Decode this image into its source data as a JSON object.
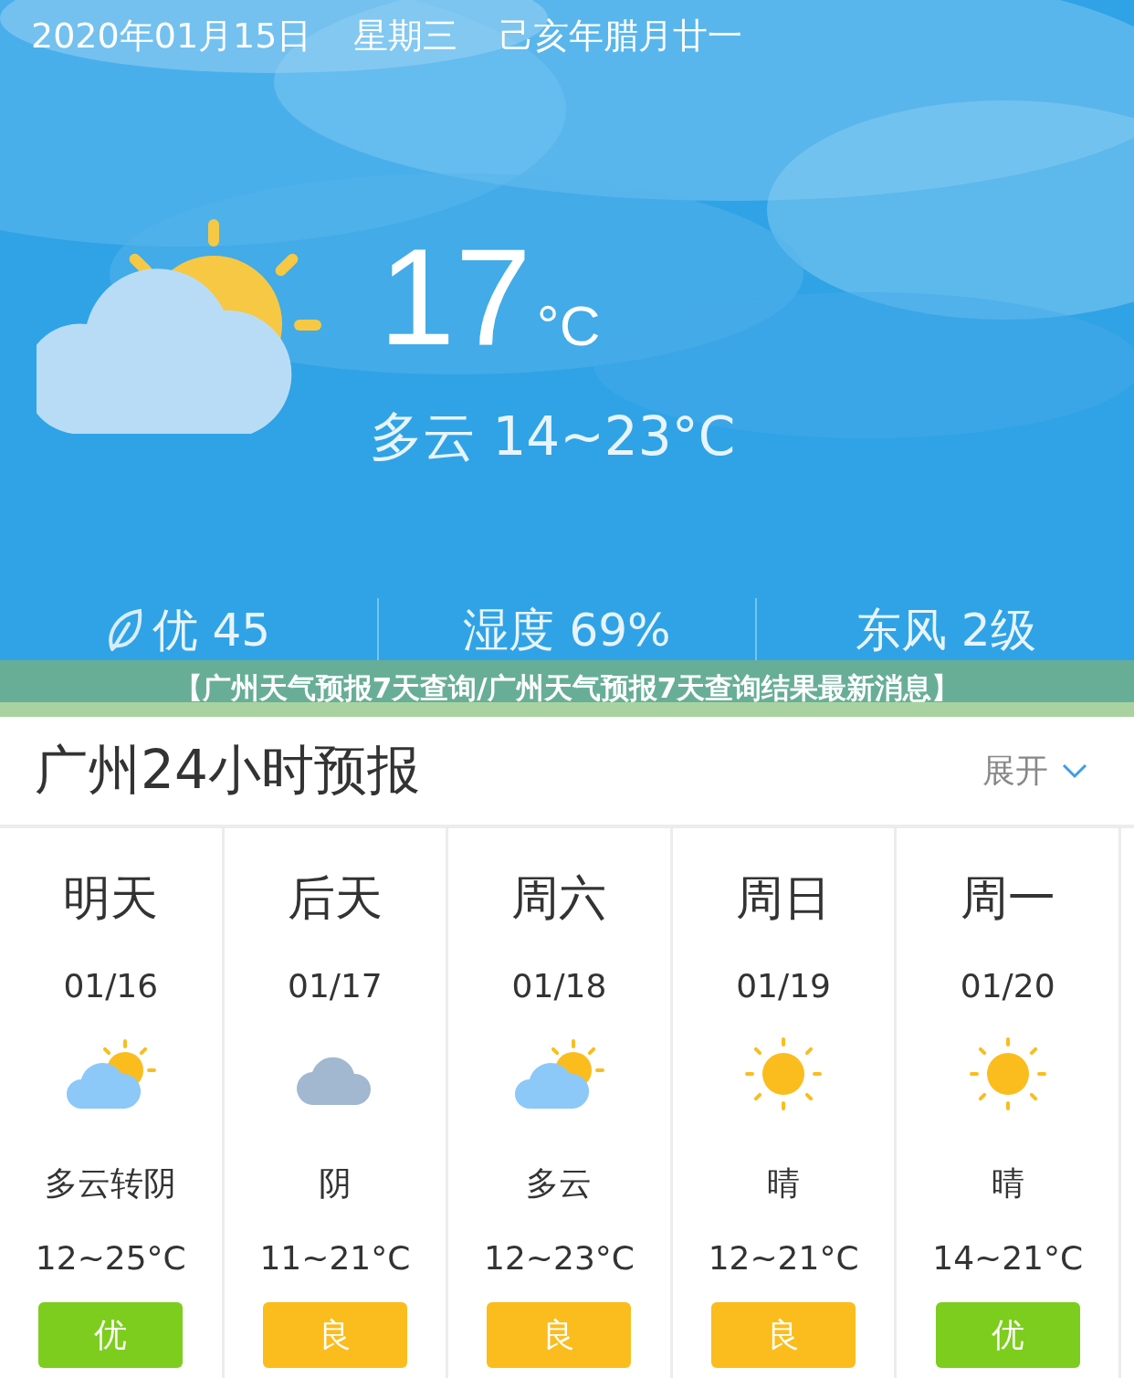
{
  "header": {
    "date": "2020年01月15日",
    "weekday": "星期三",
    "lunar": "己亥年腊月廿一",
    "temperature": "17",
    "unit": "°C",
    "condition": "多云 14~23°C",
    "stats": [
      {
        "kind": "aqi",
        "text": "优 45"
      },
      {
        "kind": "plain",
        "text": "湿度 69%"
      },
      {
        "kind": "plain",
        "text": "东风 2级"
      }
    ]
  },
  "banner": "【广州天气预报7天查询/广州天气预报7天查询结果最新消息】",
  "forecast": {
    "title": "广州24小时预报",
    "expand": "展开",
    "days": [
      {
        "day": "明天",
        "date": "01/16",
        "kind": "partly-cloudy",
        "weather": "多云转阴",
        "range": "12~25°C",
        "quality": "优",
        "color": "#7ccd1e"
      },
      {
        "day": "后天",
        "date": "01/17",
        "kind": "cloudy",
        "weather": "阴",
        "range": "11~21°C",
        "quality": "良",
        "color": "#fbbd1d"
      },
      {
        "day": "周六",
        "date": "01/18",
        "kind": "partly-cloudy",
        "weather": "多云",
        "range": "12~23°C",
        "quality": "良",
        "color": "#fbbd1d"
      },
      {
        "day": "周日",
        "date": "01/19",
        "kind": "sunny",
        "weather": "晴",
        "range": "12~21°C",
        "quality": "良",
        "color": "#fbbd1d"
      },
      {
        "day": "周一",
        "date": "01/20",
        "kind": "sunny",
        "weather": "晴",
        "range": "14~21°C",
        "quality": "优",
        "color": "#7ccd1e"
      }
    ]
  }
}
